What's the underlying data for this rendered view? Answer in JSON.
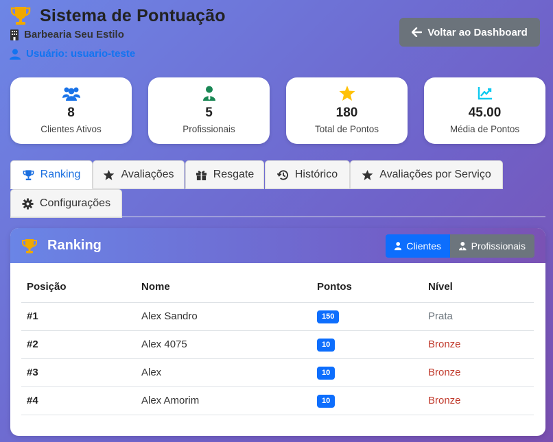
{
  "header": {
    "title": "Sistema de Pontuação",
    "business": "Barbearia Seu Estilo",
    "user": "Usuário: usuario-teste",
    "back_button": "Voltar ao Dashboard"
  },
  "stats": [
    {
      "icon": "users-icon",
      "value": "8",
      "label": "Clientes Ativos",
      "color": "#1a73e8"
    },
    {
      "icon": "professional-icon",
      "value": "5",
      "label": "Profissionais",
      "color": "#198754"
    },
    {
      "icon": "star-icon",
      "value": "180",
      "label": "Total de Pontos",
      "color": "#ffc107"
    },
    {
      "icon": "chart-line-icon",
      "value": "45.00",
      "label": "Média de Pontos",
      "color": "#0dcaf0"
    }
  ],
  "tabs": [
    {
      "label": "Ranking",
      "icon": "trophy-icon",
      "active": true
    },
    {
      "label": "Avaliações",
      "icon": "star-icon",
      "active": false
    },
    {
      "label": "Resgate",
      "icon": "gift-icon",
      "active": false
    },
    {
      "label": "Histórico",
      "icon": "history-icon",
      "active": false
    },
    {
      "label": "Avaliações por Serviço",
      "icon": "star-icon",
      "active": false
    },
    {
      "label": "Configurações",
      "icon": "gear-icon",
      "active": false
    }
  ],
  "ranking": {
    "title": "Ranking",
    "toggle": {
      "clientes": "Clientes",
      "profissionais": "Profissionais"
    },
    "columns": [
      "Posição",
      "Nome",
      "Pontos",
      "Nível"
    ],
    "rows": [
      {
        "pos": "#1",
        "name": "Alex Sandro",
        "points": "150",
        "level": "Prata"
      },
      {
        "pos": "#2",
        "name": "Alex 4075",
        "points": "10",
        "level": "Bronze"
      },
      {
        "pos": "#3",
        "name": "Alex",
        "points": "10",
        "level": "Bronze"
      },
      {
        "pos": "#4",
        "name": "Alex Amorim",
        "points": "10",
        "level": "Bronze"
      }
    ]
  },
  "colors": {
    "accent": "#0d6efd",
    "trophy": "#f0a800",
    "prata": "#6c757d",
    "bronze": "#c0392b"
  }
}
